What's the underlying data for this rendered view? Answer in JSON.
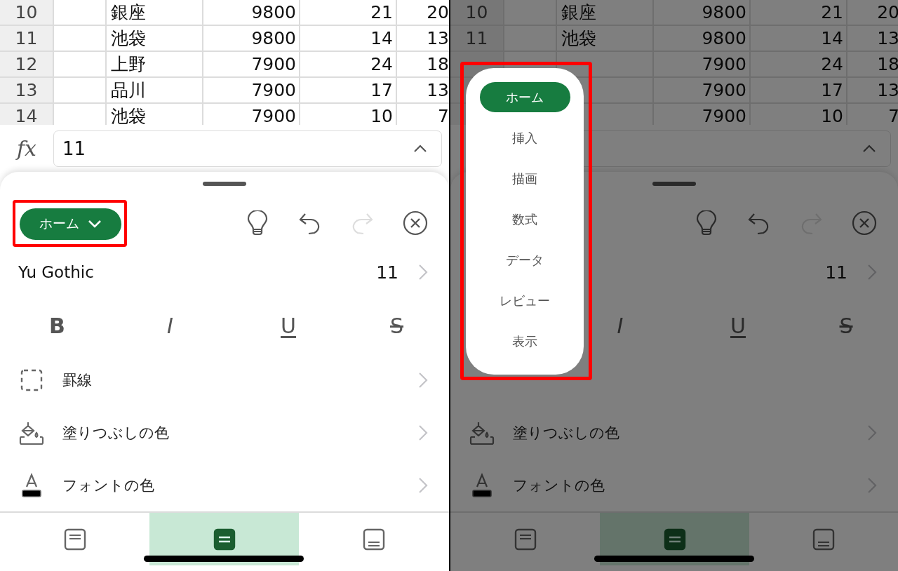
{
  "screens": [
    {
      "rows": [
        {
          "row_number": "10",
          "column_3": "銀座",
          "column_4": "9800",
          "column_5": "21",
          "column_6": "20"
        },
        {
          "row_number": "11",
          "column_3": "池袋",
          "column_4": "9800",
          "column_5": "14",
          "column_6": "13"
        },
        {
          "row_number": "12",
          "column_3": "上野",
          "column_4": "7900",
          "column_5": "24",
          "column_6": "18"
        },
        {
          "row_number": "13",
          "column_3": "品川",
          "column_4": "7900",
          "column_5": "17",
          "column_6": "13"
        },
        {
          "row_number": "14",
          "column_3": "池袋",
          "column_4": "7900",
          "column_5": "10",
          "column_6": "7"
        }
      ],
      "formula_bar": {
        "label": "fx",
        "value": "11"
      },
      "tab_selector": {
        "label": "ホーム",
        "highlighted": true
      },
      "toolbar": [
        {
          "kind": "tips",
          "disabled": false
        },
        {
          "kind": "undo",
          "disabled": false
        },
        {
          "kind": "redo",
          "disabled": true
        },
        {
          "kind": "close",
          "disabled": false
        }
      ],
      "font": {
        "name": "Yu Gothic",
        "size": "11"
      },
      "format_buttons": [
        {
          "kind": "bold",
          "label": "B"
        },
        {
          "kind": "italic",
          "label": "I"
        },
        {
          "kind": "underline",
          "label": "U"
        },
        {
          "kind": "strikethrough",
          "label": "S"
        }
      ],
      "options": [
        {
          "kind": "borders",
          "label": "罫線"
        },
        {
          "kind": "fill",
          "label": "塗りつぶしの色"
        },
        {
          "kind": "font_color",
          "label": "フォントの色"
        }
      ],
      "bottom_tabs": [
        {
          "kind": "top",
          "selected": false
        },
        {
          "kind": "middle",
          "selected": true
        },
        {
          "kind": "bottom",
          "selected": false
        }
      ]
    },
    {
      "dimmed": true,
      "rows": [
        {
          "row_number": "10",
          "column_3": "銀座",
          "column_4": "9800",
          "column_5": "21",
          "column_6": "20"
        },
        {
          "row_number": "11",
          "column_3": "池袋",
          "column_4": "9800",
          "column_5": "14",
          "column_6": "13"
        },
        {
          "column_4": "7900",
          "column_5": "24",
          "column_6": "18"
        },
        {
          "column_4": "7900",
          "column_5": "17",
          "column_6": "13"
        },
        {
          "column_4": "7900",
          "column_5": "10",
          "column_6": "7"
        }
      ],
      "toolbar": [
        {
          "kind": "tips",
          "disabled": false
        },
        {
          "kind": "undo",
          "disabled": false
        },
        {
          "kind": "redo",
          "disabled": true
        },
        {
          "kind": "close",
          "disabled": false
        }
      ],
      "font": {
        "size": "11"
      },
      "format_buttons": [
        {
          "kind": "covered"
        },
        {
          "kind": "italic",
          "label": "I"
        },
        {
          "kind": "underline",
          "label": "U"
        },
        {
          "kind": "strikethrough",
          "label": "S"
        }
      ],
      "options": [
        {
          "kind": "covered"
        },
        {
          "kind": "fill",
          "label": "塗りつぶしの色"
        },
        {
          "kind": "font_color",
          "label": "フォントの色"
        }
      ],
      "bottom_tabs": [
        {
          "kind": "top",
          "selected": false
        },
        {
          "kind": "middle",
          "selected": true
        },
        {
          "kind": "bottom",
          "selected": false
        }
      ],
      "tab_menu": {
        "highlighted": true,
        "items": [
          {
            "label": "ホーム",
            "selected": true
          },
          {
            "label": "挿入",
            "selected": false
          },
          {
            "label": "描画",
            "selected": false
          },
          {
            "label": "数式",
            "selected": false
          },
          {
            "label": "データ",
            "selected": false
          },
          {
            "label": "レビュー",
            "selected": false
          },
          {
            "label": "表示",
            "selected": false
          }
        ]
      }
    }
  ]
}
